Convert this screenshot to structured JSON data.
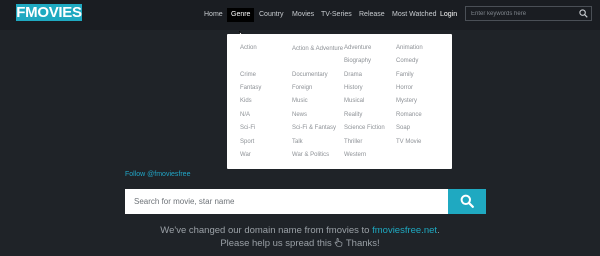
{
  "brand": {
    "logo_text": "FMOVIES"
  },
  "nav": {
    "items": [
      {
        "label": "Home"
      },
      {
        "label": "Genre"
      },
      {
        "label": "Country"
      },
      {
        "label": "Movies"
      },
      {
        "label": "TV-Series"
      },
      {
        "label": "Release"
      },
      {
        "label": "Most Watched"
      }
    ],
    "login": "Login",
    "search_placeholder": "Enter keywords here"
  },
  "genres": [
    [
      "Action",
      "Action & Adventure",
      "Adventure",
      "Animation"
    ],
    [
      "",
      "",
      "Biography",
      "Comedy"
    ],
    [
      "Crime",
      "Documentary",
      "Drama",
      "Family"
    ],
    [
      "Fantasy",
      "Foreign",
      "History",
      "Horror"
    ],
    [
      "Kids",
      "Music",
      "Musical",
      "Mystery"
    ],
    [
      "N/A",
      "News",
      "Reality",
      "Romance"
    ],
    [
      "Sci-Fi",
      "Sci-Fi & Fantasy",
      "Science Fiction",
      "Soap"
    ],
    [
      "Sport",
      "Talk",
      "Thriller",
      "TV Movie"
    ],
    [
      "War",
      "War & Politics",
      "Western",
      ""
    ]
  ],
  "follow": "Follow @fmoviesfree",
  "main_search": {
    "placeholder": "Search for movie, star name"
  },
  "notice": {
    "line1_prefix": "We've changed our domain name from fmovies to ",
    "line1_link": "fmoviesfree.net",
    "line1_suffix": ".",
    "line2_prefix": "Please help us spread this",
    "line2_suffix": "Thanks!"
  },
  "colors": {
    "accent": "#1fa9c1",
    "background": "#1f2328",
    "header": "#1a1d22"
  }
}
